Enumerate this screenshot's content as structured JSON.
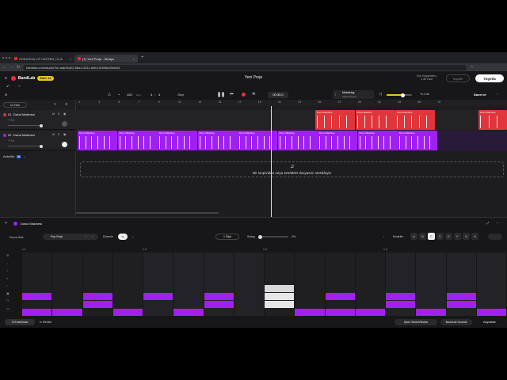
{
  "browser": {
    "tabs": [
      {
        "label": "CREATION OF HATRED | İs İs",
        "active": false
      },
      {
        "label": "(1) Yeni Proje - Stüdyo",
        "active": true
      }
    ],
    "new_tab": "+",
    "url": "bandlab.com/studio?id=aab45d22-86a3-4311-8e64-6045bd354e81"
  },
  "app": {
    "brand": "BandLab",
    "plan_badge": "Edin 12",
    "project_title": "Yeni Proje",
    "save_status": "Son Kaydedilen:",
    "save_time": "1 dk önce",
    "save_button": "Kaydet",
    "publish_button": "Yayınla"
  },
  "toolbar": {
    "tempo": "120",
    "tempo_unit": "bpm",
    "time_sig_top": "4",
    "time_sig_bottom": "4",
    "key": "Ökçi",
    "time": "00:39.0",
    "mastering_label": "Mastering",
    "mastering_preset": "Select Preset",
    "master_volume": "+0.0 db",
    "invite": "Davet et"
  },
  "tracks_panel": {
    "add_track": "İz Ekle",
    "autotrim": "AutoMix",
    "tracks": [
      {
        "number": "01",
        "name": "Davul Makinesi",
        "fx": "+ Fx",
        "color": "#e0353b"
      },
      {
        "number": "02",
        "name": "Davul Makinesi",
        "fx": "+ Fx",
        "color": "#a020f0"
      }
    ]
  },
  "timeline": {
    "ruler_marks": [
      "1",
      "3",
      "5",
      "7",
      "9",
      "11",
      "13",
      "15",
      "17",
      "19",
      "21",
      "23",
      "25",
      "27",
      "29",
      "31",
      "33",
      "35",
      "37"
    ],
    "clip_label": "Drum Machine",
    "dropzone_text": "Bir loop/video veya ses/MIDI dosyasını sürükleyin"
  },
  "editor": {
    "title": "Davul Makinesi",
    "kit_label": "Drum Kits",
    "kit_value": "Pop Rock",
    "pattern_label": "Düzenle",
    "pattern_toggle": "Ye",
    "pattern_count": "1 Ölçü",
    "swing_label": "Swing",
    "swing_value": "0%",
    "models_label": "Modeller",
    "models": [
      "A",
      "B",
      "C",
      "D",
      "E",
      "F",
      "G",
      "H"
    ],
    "selected_model": "C",
    "ruler_marks": [
      "1.1",
      "1.2",
      "1.3",
      "1.4"
    ],
    "row_labels": [
      "",
      "",
      "",
      "",
      "",
      "",
      "",
      ""
    ],
    "footer_left": "Enstrüman",
    "footer_fx": "Efektler",
    "footer_right1": "Şarkı Sözleri/Notlar",
    "footer_right2": "BandLab Sounds",
    "footer_right3": "Kaynaklar"
  },
  "colors": {
    "accent_red": "#e0353b",
    "accent_purple": "#a020f0",
    "bg": "#1b1b1d"
  }
}
